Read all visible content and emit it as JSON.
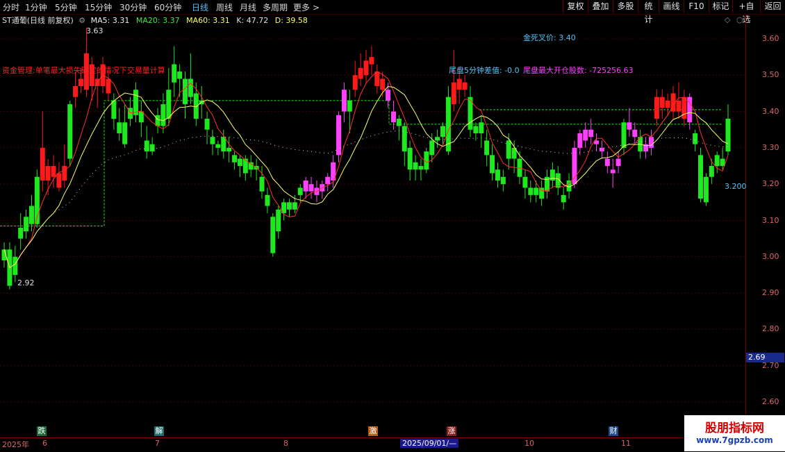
{
  "toolbar": {
    "periods": [
      "分时",
      "1分钟",
      "5分钟",
      "15分钟",
      "30分钟",
      "60分钟",
      "日线",
      "周线",
      "月线",
      "多周期",
      "更多 >"
    ],
    "active_period": "日线",
    "right_buttons": [
      "复权",
      "叠加",
      "多股",
      "统计",
      "画线",
      "F10",
      "标记",
      "+自选",
      "返回"
    ]
  },
  "info": {
    "title": "ST通葡(日线 前复权)",
    "ma5": "MA5: 3.31",
    "ma20": "MA20: 3.37",
    "ma60": "MA60: 3.31",
    "k": "K: 47.72",
    "d": "D: 39.58"
  },
  "annotations": {
    "high_label": "3.63",
    "low_label": "2.92",
    "golden_cross": "金死叉价: 3.40",
    "tail_diff": "尾盘5分钟差值: -0.0",
    "tail_pos": "尾盘最大开仓股数: -725256.63",
    "money_mgmt": "资金管理:单笔最大损失确定的情况下交易量计算",
    "level": "3.200",
    "price_box": "2.69"
  },
  "y_axis": {
    "ticks": [
      "3.60",
      "3.50",
      "3.40",
      "3.30",
      "3.20",
      "3.10",
      "3.00",
      "2.90",
      "2.80",
      "2.70",
      "2.60"
    ]
  },
  "x_axis": {
    "labels": [
      "2025年",
      "6",
      "7",
      "8",
      "2025/09/01/—",
      "10",
      "11"
    ]
  },
  "markers": [
    {
      "text": "跌",
      "color": "#1e6b3a"
    },
    {
      "text": "解",
      "color": "#1e6b6b"
    },
    {
      "text": "激",
      "color": "#b85a1e"
    },
    {
      "text": "涨",
      "color": "#8a1e1e"
    },
    {
      "text": "财",
      "color": "#1e4a8a"
    }
  ],
  "watermark": {
    "line1": "股朋指标网",
    "line2": "www.7gpzb.com"
  },
  "colors": {
    "up": "#ff1a1a",
    "down": "#1ee81e",
    "magenta": "#ff40ff",
    "ma5": "#ffffff",
    "ma20": "#ffff66",
    "ma60": "#d0d0d0",
    "grid": "#4a0000"
  },
  "chart_data": {
    "type": "candlestick",
    "ylim": [
      2.55,
      3.65
    ],
    "candles": [
      [
        2.99,
        3.02,
        3.04,
        2.97,
        "g"
      ],
      [
        3.02,
        2.92,
        3.04,
        2.91,
        "g"
      ],
      [
        2.95,
        3.0,
        3.03,
        2.93,
        "g"
      ],
      [
        3.05,
        3.08,
        3.12,
        3.02,
        "g"
      ],
      [
        3.07,
        3.11,
        3.13,
        3.05,
        "g"
      ],
      [
        3.09,
        3.14,
        3.17,
        3.07,
        "g"
      ],
      [
        3.09,
        3.22,
        3.24,
        3.08,
        "g"
      ],
      [
        3.3,
        3.21,
        3.4,
        3.18,
        "r"
      ],
      [
        3.21,
        3.25,
        3.27,
        3.17,
        "r"
      ],
      [
        3.22,
        3.25,
        3.28,
        3.19,
        "r"
      ],
      [
        3.19,
        3.23,
        3.26,
        3.18,
        "r"
      ],
      [
        3.21,
        3.25,
        3.31,
        3.19,
        "r"
      ],
      [
        3.42,
        3.27,
        3.43,
        3.25,
        "g"
      ],
      [
        3.47,
        3.44,
        3.51,
        3.41,
        "r"
      ],
      [
        3.47,
        3.49,
        3.52,
        3.45,
        "r"
      ],
      [
        3.56,
        3.46,
        3.63,
        3.44,
        "r"
      ],
      [
        3.47,
        3.53,
        3.55,
        3.43,
        "r"
      ],
      [
        3.47,
        3.49,
        3.52,
        3.41,
        "r"
      ],
      [
        3.47,
        3.53,
        3.55,
        3.45,
        "r"
      ],
      [
        3.49,
        3.45,
        3.51,
        3.43,
        "r"
      ],
      [
        3.43,
        3.38,
        3.45,
        3.35,
        "g"
      ],
      [
        3.34,
        3.37,
        3.41,
        3.32,
        "g"
      ],
      [
        3.31,
        3.37,
        3.42,
        3.3,
        "g"
      ],
      [
        3.38,
        3.41,
        3.44,
        3.36,
        "g"
      ],
      [
        3.39,
        3.46,
        3.48,
        3.37,
        "g"
      ],
      [
        3.37,
        3.4,
        3.43,
        3.33,
        "g"
      ],
      [
        3.32,
        3.29,
        3.36,
        3.27,
        "g"
      ],
      [
        3.31,
        3.29,
        3.33,
        3.28,
        "g"
      ],
      [
        3.39,
        3.36,
        3.41,
        3.34,
        "g"
      ],
      [
        3.36,
        3.42,
        3.45,
        3.34,
        "g"
      ],
      [
        3.38,
        3.46,
        3.52,
        3.36,
        "g"
      ],
      [
        3.48,
        3.53,
        3.58,
        3.44,
        "g"
      ],
      [
        3.51,
        3.49,
        3.53,
        3.44,
        "g"
      ],
      [
        3.49,
        3.42,
        3.51,
        3.38,
        "g"
      ],
      [
        3.44,
        3.49,
        3.56,
        3.42,
        "g"
      ],
      [
        3.45,
        3.38,
        3.48,
        3.36,
        "g"
      ],
      [
        3.43,
        3.42,
        3.47,
        3.38,
        "g"
      ],
      [
        3.38,
        3.35,
        3.4,
        3.31,
        "g"
      ],
      [
        3.33,
        3.31,
        3.35,
        3.28,
        "g"
      ],
      [
        3.31,
        3.3,
        3.32,
        3.28,
        "g"
      ],
      [
        3.33,
        3.29,
        3.35,
        3.27,
        "g"
      ],
      [
        3.29,
        3.3,
        3.33,
        3.26,
        "g"
      ],
      [
        3.28,
        3.26,
        3.29,
        3.24,
        "g"
      ],
      [
        3.27,
        3.25,
        3.28,
        3.22,
        "g"
      ],
      [
        3.27,
        3.23,
        3.28,
        3.21,
        "g"
      ],
      [
        3.26,
        3.24,
        3.28,
        3.22,
        "g"
      ],
      [
        3.24,
        3.25,
        3.27,
        3.21,
        "g"
      ],
      [
        3.22,
        3.18,
        3.25,
        3.16,
        "g"
      ],
      [
        3.17,
        3.14,
        3.19,
        3.12,
        "g"
      ],
      [
        3.11,
        3.01,
        3.12,
        3.0,
        "g"
      ],
      [
        3.07,
        3.13,
        3.14,
        3.05,
        "g"
      ],
      [
        3.15,
        3.12,
        3.16,
        3.1,
        "g"
      ],
      [
        3.13,
        3.15,
        3.16,
        3.11,
        "g"
      ],
      [
        3.13,
        3.15,
        3.17,
        3.12,
        "g"
      ],
      [
        3.17,
        3.19,
        3.2,
        3.15,
        "g"
      ],
      [
        3.18,
        3.21,
        3.22,
        3.16,
        "m"
      ],
      [
        3.2,
        3.18,
        3.22,
        3.16,
        "m"
      ],
      [
        3.19,
        3.17,
        3.21,
        3.15,
        "m"
      ],
      [
        3.18,
        3.2,
        3.21,
        3.16,
        "m"
      ],
      [
        3.2,
        3.22,
        3.23,
        3.18,
        "m"
      ],
      [
        3.21,
        3.26,
        3.28,
        3.19,
        "m"
      ],
      [
        3.28,
        3.39,
        3.4,
        3.26,
        "m"
      ],
      [
        3.4,
        3.46,
        3.48,
        3.37,
        "m"
      ],
      [
        3.43,
        3.4,
        3.46,
        3.34,
        "g"
      ],
      [
        3.46,
        3.5,
        3.54,
        3.44,
        "r"
      ],
      [
        3.52,
        3.49,
        3.56,
        3.47,
        "r"
      ],
      [
        3.5,
        3.54,
        3.57,
        3.48,
        "r"
      ],
      [
        3.53,
        3.55,
        3.58,
        3.5,
        "r"
      ],
      [
        3.51,
        3.47,
        3.53,
        3.45,
        "r"
      ],
      [
        3.49,
        3.46,
        3.51,
        3.44,
        "r"
      ],
      [
        3.46,
        3.43,
        3.48,
        3.41,
        "m"
      ],
      [
        3.4,
        3.37,
        3.43,
        3.35,
        "m"
      ],
      [
        3.38,
        3.36,
        3.39,
        3.32,
        "g"
      ],
      [
        3.36,
        3.29,
        3.37,
        3.25,
        "g"
      ],
      [
        3.3,
        3.24,
        3.32,
        3.21,
        "g"
      ],
      [
        3.26,
        3.24,
        3.28,
        3.21,
        "g"
      ],
      [
        3.25,
        3.24,
        3.27,
        3.21,
        "g"
      ],
      [
        3.24,
        3.29,
        3.3,
        3.23,
        "g"
      ],
      [
        3.28,
        3.32,
        3.34,
        3.26,
        "g"
      ],
      [
        3.32,
        3.33,
        3.35,
        3.3,
        "g"
      ],
      [
        3.33,
        3.36,
        3.37,
        3.31,
        "g"
      ],
      [
        3.29,
        3.44,
        3.47,
        3.28,
        "g"
      ],
      [
        3.48,
        3.42,
        3.57,
        3.4,
        "r"
      ],
      [
        3.46,
        3.49,
        3.52,
        3.42,
        "r"
      ],
      [
        3.48,
        3.46,
        3.5,
        3.44,
        "r"
      ],
      [
        3.44,
        3.35,
        3.47,
        3.33,
        "g"
      ],
      [
        3.36,
        3.34,
        3.37,
        3.32,
        "g"
      ],
      [
        3.34,
        3.37,
        3.39,
        3.3,
        "g"
      ],
      [
        3.32,
        3.28,
        3.35,
        3.25,
        "g"
      ],
      [
        3.28,
        3.23,
        3.31,
        3.21,
        "g"
      ],
      [
        3.24,
        3.21,
        3.26,
        3.19,
        "g"
      ],
      [
        3.22,
        3.2,
        3.24,
        3.18,
        "g"
      ],
      [
        3.27,
        3.32,
        3.34,
        3.24,
        "g"
      ],
      [
        3.3,
        3.27,
        3.32,
        3.23,
        "g"
      ],
      [
        3.27,
        3.22,
        3.29,
        3.2,
        "g"
      ],
      [
        3.22,
        3.19,
        3.24,
        3.16,
        "g"
      ],
      [
        3.19,
        3.17,
        3.21,
        3.15,
        "g"
      ],
      [
        3.19,
        3.17,
        3.21,
        3.15,
        "g"
      ],
      [
        3.19,
        3.16,
        3.21,
        3.14,
        "g"
      ],
      [
        3.18,
        3.22,
        3.24,
        3.16,
        "g"
      ],
      [
        3.21,
        3.24,
        3.26,
        3.19,
        "g"
      ],
      [
        3.23,
        3.19,
        3.25,
        3.17,
        "g"
      ],
      [
        3.17,
        3.15,
        3.19,
        3.13,
        "g"
      ],
      [
        3.18,
        3.21,
        3.23,
        3.16,
        "g"
      ],
      [
        3.2,
        3.3,
        3.32,
        3.19,
        "m"
      ],
      [
        3.3,
        3.34,
        3.35,
        3.28,
        "m"
      ],
      [
        3.35,
        3.32,
        3.37,
        3.3,
        "m"
      ],
      [
        3.33,
        3.35,
        3.38,
        3.31,
        "m"
      ],
      [
        3.31,
        3.32,
        3.34,
        3.29,
        "m"
      ],
      [
        3.29,
        3.3,
        3.32,
        3.27,
        "m"
      ],
      [
        3.27,
        3.25,
        3.29,
        3.23,
        "m"
      ],
      [
        3.24,
        3.23,
        3.27,
        3.19,
        "m"
      ],
      [
        3.25,
        3.27,
        3.29,
        3.23,
        "m"
      ],
      [
        3.3,
        3.37,
        3.38,
        3.28,
        "g"
      ],
      [
        3.37,
        3.35,
        3.41,
        3.33,
        "m"
      ],
      [
        3.35,
        3.33,
        3.37,
        3.31,
        "m"
      ],
      [
        3.29,
        3.33,
        3.35,
        3.27,
        "g"
      ],
      [
        3.29,
        3.31,
        3.33,
        3.27,
        "m"
      ],
      [
        3.3,
        3.33,
        3.35,
        3.28,
        "m"
      ],
      [
        3.38,
        3.44,
        3.46,
        3.36,
        "r"
      ],
      [
        3.41,
        3.44,
        3.46,
        3.38,
        "r"
      ],
      [
        3.41,
        3.43,
        3.45,
        3.39,
        "r"
      ],
      [
        3.4,
        3.45,
        3.47,
        3.38,
        "r"
      ],
      [
        3.4,
        3.43,
        3.48,
        3.38,
        "r"
      ],
      [
        3.38,
        3.44,
        3.46,
        3.36,
        "r"
      ],
      [
        3.44,
        3.37,
        3.45,
        3.35,
        "m"
      ],
      [
        3.34,
        3.31,
        3.35,
        3.29,
        "g"
      ],
      [
        3.28,
        3.16,
        3.3,
        3.15,
        "g"
      ],
      [
        3.15,
        3.22,
        3.23,
        3.14,
        "g"
      ],
      [
        3.22,
        3.25,
        3.27,
        3.2,
        "g"
      ],
      [
        3.25,
        3.28,
        3.29,
        3.23,
        "g"
      ],
      [
        3.25,
        3.27,
        3.3,
        3.24,
        "g"
      ],
      [
        3.29,
        3.38,
        3.42,
        3.28,
        "g"
      ]
    ]
  }
}
